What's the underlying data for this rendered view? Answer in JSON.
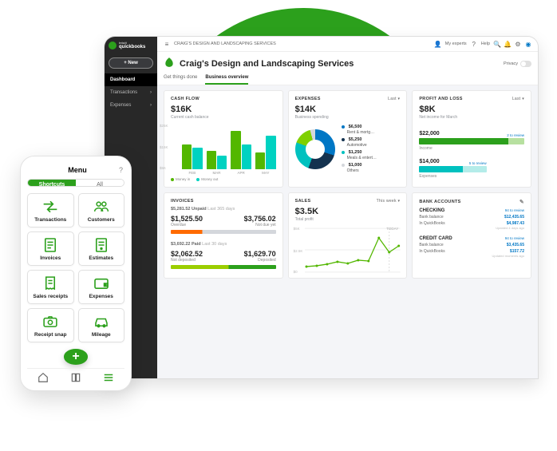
{
  "brand": {
    "logo_label": "quickbooks",
    "intuit": "intuit"
  },
  "sidebar": {
    "new_button": "+ New",
    "items": [
      {
        "label": "Dashboard",
        "active": true
      },
      {
        "label": "Transactions",
        "active": false
      },
      {
        "label": "Expenses",
        "active": false
      }
    ]
  },
  "topbar": {
    "breadcrumb": "CRAIG'S DESIGN AND LANDSCAPING SERVICES",
    "my_experts": "My experts",
    "help": "Help"
  },
  "page": {
    "title": "Craig's Design and Landscaping Services",
    "privacy_label": "Privacy"
  },
  "tabs": [
    {
      "label": "Get things done",
      "active": false
    },
    {
      "label": "Business overview",
      "active": true
    }
  ],
  "cards": {
    "cashflow": {
      "header": "CASH FLOW",
      "amount": "$16K",
      "subtitle": "Current cash balance",
      "legend_in": "Money in",
      "legend_out": "Money out"
    },
    "expenses": {
      "header": "EXPENSES",
      "selector": "Last",
      "amount": "$14K",
      "subtitle": "Business spending",
      "items": [
        {
          "amount": "$6,500",
          "label": "Rent & mortg…",
          "color": "#0077c5"
        },
        {
          "amount": "$5,250",
          "label": "Automotive",
          "color": "#14324f"
        },
        {
          "amount": "$1,250",
          "label": "Meals & entert…",
          "color": "#00c1bf"
        },
        {
          "amount": "$1,000",
          "label": "Others",
          "color": "#d4d7dc"
        }
      ]
    },
    "profitloss": {
      "header": "PROFIT AND LOSS",
      "selector": "Last",
      "amount": "$8K",
      "subtitle": "Net income for March",
      "income": {
        "value": "$22,000",
        "label": "Income",
        "review": "2 to review"
      },
      "expenses": {
        "value": "$14,000",
        "label": "Expenses",
        "review": "5 to review"
      }
    },
    "invoices": {
      "header": "INVOICES",
      "unpaid": {
        "total": "$5,281.52 Unpaid",
        "period": "Last 365 days",
        "overdue_amt": "$1,525.50",
        "overdue_lbl": "Overdue",
        "notdue_amt": "$3,756.02",
        "notdue_lbl": "Not due yet"
      },
      "paid": {
        "total": "$3,692.22 Paid",
        "period": "Last 30 days",
        "notdep_amt": "$2,062.52",
        "notdep_lbl": "Not deposited",
        "dep_amt": "$1,629.70",
        "dep_lbl": "Deposited"
      }
    },
    "sales": {
      "header": "SALES",
      "selector": "This week",
      "amount": "$3.5K",
      "subtitle": "Total profit",
      "today_label": "TODAY",
      "y_top": "$5K",
      "y_mid": "$2.5K",
      "y_bot": "$0"
    },
    "bank": {
      "header": "BANK ACCOUNTS",
      "checking": {
        "title": "CHECKING",
        "review": "94 to review",
        "rows": [
          {
            "label": "Bank balance",
            "value": "$12,435.65",
            "meta": "Updated 4 days ago"
          },
          {
            "label": "In QuickBooks",
            "value": "$4,987.43",
            "meta": ""
          }
        ]
      },
      "credit": {
        "title": "CREDIT CARD",
        "review": "94 to review",
        "rows": [
          {
            "label": "Bank balance",
            "value": "$3,435.65",
            "meta": "Updated moments ago"
          },
          {
            "label": "In QuickBooks",
            "value": "$157.72",
            "meta": ""
          }
        ]
      }
    }
  },
  "chart_data": {
    "cashflow_bars": {
      "type": "bar",
      "ylim": [
        0,
        25000
      ],
      "yticks": [
        "$25K",
        "$15K",
        "$5K"
      ],
      "categories": [
        "FEB",
        "MAR",
        "APR",
        "MAY"
      ],
      "series": [
        {
          "name": "Money in",
          "color": "#53b700",
          "values": [
            15000,
            11000,
            23000,
            10000
          ]
        },
        {
          "name": "Money out",
          "color": "#00d2c1",
          "values": [
            13000,
            8000,
            15000,
            20000
          ]
        }
      ]
    },
    "sales_line": {
      "type": "line",
      "ylim": [
        0,
        5000
      ],
      "points": [
        600,
        700,
        900,
        1200,
        1000,
        1400,
        1300,
        3800,
        2200,
        3000
      ]
    }
  },
  "phone": {
    "menu_title": "Menu",
    "seg_shortcuts": "Shortcuts",
    "seg_all": "All",
    "tiles": [
      {
        "label": "Transactions"
      },
      {
        "label": "Customers"
      },
      {
        "label": "Invoices"
      },
      {
        "label": "Estimates"
      },
      {
        "label": "Sales receipts"
      },
      {
        "label": "Expenses"
      },
      {
        "label": "Receipt snap"
      },
      {
        "label": "Mileage"
      }
    ]
  }
}
